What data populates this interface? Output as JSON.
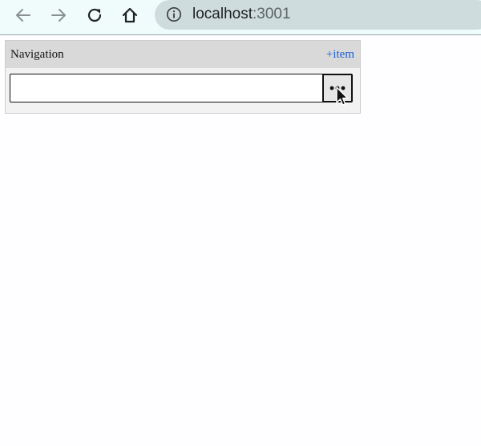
{
  "browser": {
    "back_icon": "arrow-left-icon",
    "forward_icon": "arrow-right-icon",
    "reload_icon": "reload-icon",
    "home_icon": "home-icon",
    "info_icon": "info-circle-icon",
    "url_host": "localhost",
    "url_port": ":3001",
    "colors": {
      "toolbar_bg": "#f0fbfb",
      "addressbar_bg": "#cfdcdd"
    }
  },
  "panel": {
    "title": "Navigation",
    "add_label": "+item",
    "add_color": "#1a5fd8",
    "items": [
      {
        "value": "",
        "more_icon": "ellipsis-icon"
      }
    ]
  },
  "cursor": {
    "icon": "mouse-pointer-icon"
  }
}
